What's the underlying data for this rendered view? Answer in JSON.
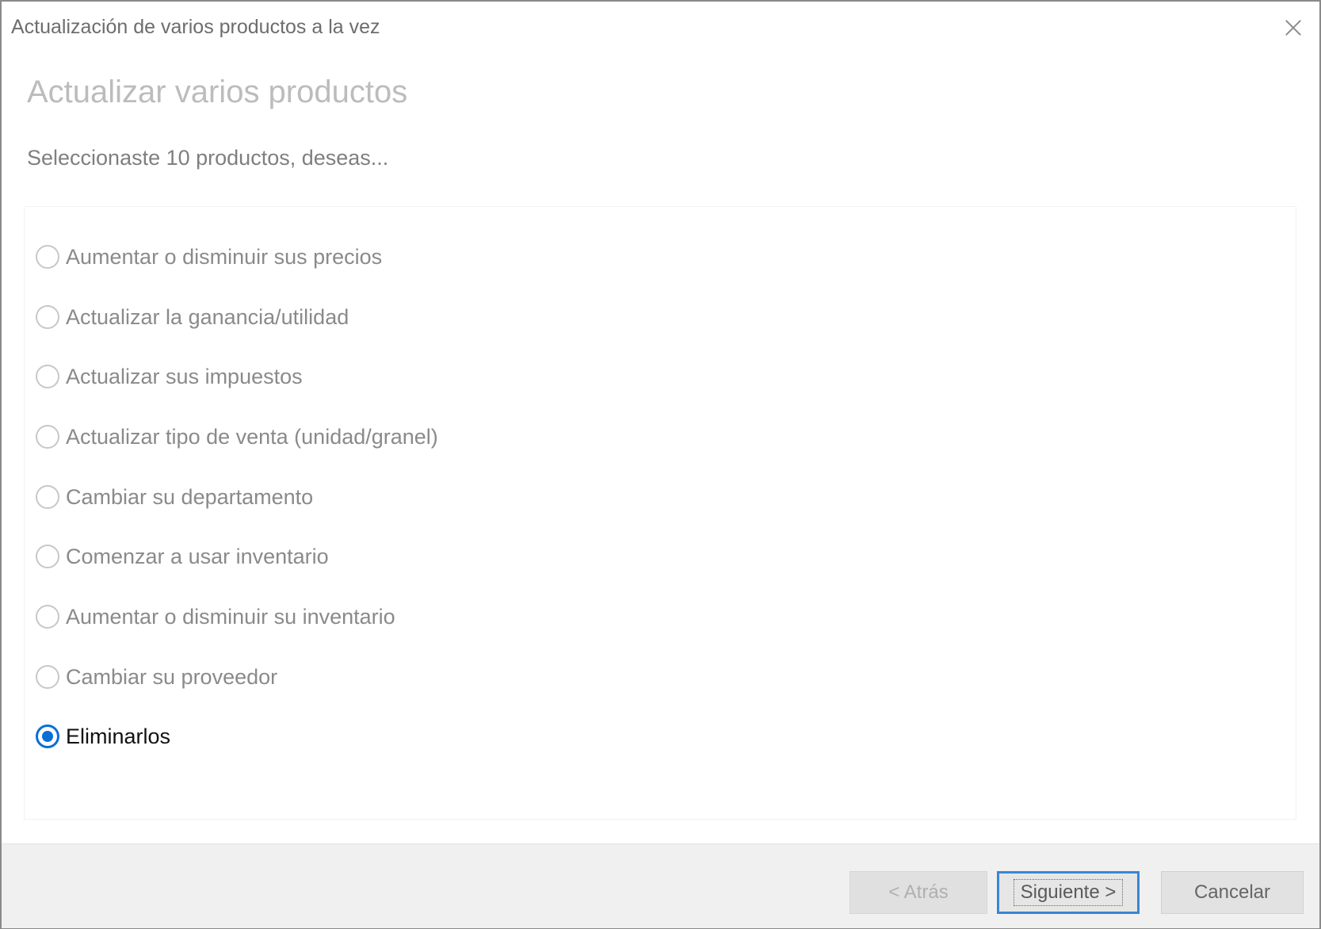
{
  "window": {
    "title": "Actualización de varios productos a la vez"
  },
  "page": {
    "heading": "Actualizar varios productos",
    "subheading": "Seleccionaste 10 productos, deseas..."
  },
  "options": [
    {
      "label": "Aumentar o disminuir sus precios",
      "selected": false
    },
    {
      "label": "Actualizar la ganancia/utilidad",
      "selected": false
    },
    {
      "label": "Actualizar sus impuestos",
      "selected": false
    },
    {
      "label": "Actualizar tipo de venta (unidad/granel)",
      "selected": false
    },
    {
      "label": "Cambiar su departamento",
      "selected": false
    },
    {
      "label": "Comenzar a usar inventario",
      "selected": false
    },
    {
      "label": "Aumentar o disminuir su inventario",
      "selected": false
    },
    {
      "label": "Cambiar su proveedor",
      "selected": false
    },
    {
      "label": "Eliminarlos",
      "selected": true
    }
  ],
  "footer": {
    "back_label": "< Atrás",
    "next_label": "Siguiente >",
    "cancel_label": "Cancelar"
  },
  "colors": {
    "accent": "#0a6fd6",
    "footer_bg": "#f0f0f0"
  }
}
